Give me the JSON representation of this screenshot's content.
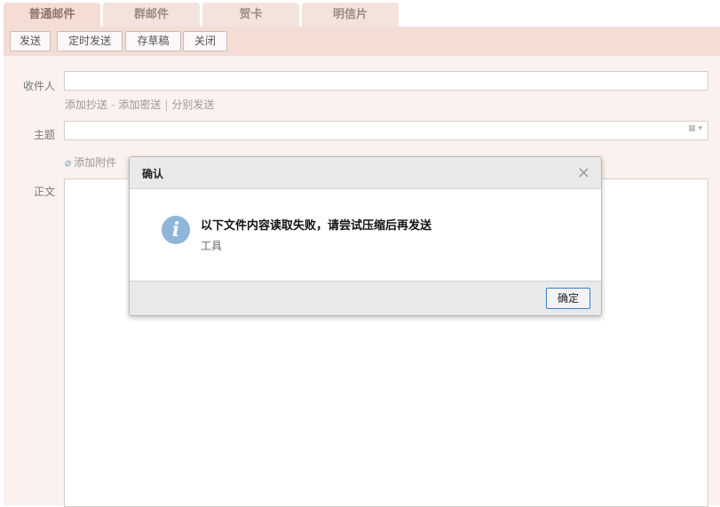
{
  "tabs": [
    "普通邮件",
    "群邮件",
    "贺卡",
    "明信片"
  ],
  "toolbar": {
    "send": "发送",
    "scheduled_send": "定时发送",
    "save_draft": "存草稿",
    "close": "关闭"
  },
  "form": {
    "recipient_label": "收件人",
    "recipient_value": "",
    "add_cc": "添加抄送",
    "add_bcc": "添加密送",
    "separate_send": "分别发送",
    "sep_dash": "-",
    "sep_bar": "|",
    "subject_label": "主题",
    "subject_value": "",
    "add_attachment": "添加附件",
    "body_label": "正文"
  },
  "dialog": {
    "title": "确认",
    "message": "以下文件内容读取失败，请尝试压缩后再发送",
    "detail": "工具",
    "ok_label": "确定",
    "close_glyph": "×",
    "info_glyph": "i"
  },
  "icons": {
    "paperclip": "paperclip-icon",
    "info": "info-icon",
    "close": "close-icon",
    "grid": "grid-icon"
  },
  "colors": {
    "accent": "#3a7fc4",
    "panel": "#fbf1ee",
    "toolbar": "#f4ddd5",
    "tab": "#f3e3dc"
  }
}
